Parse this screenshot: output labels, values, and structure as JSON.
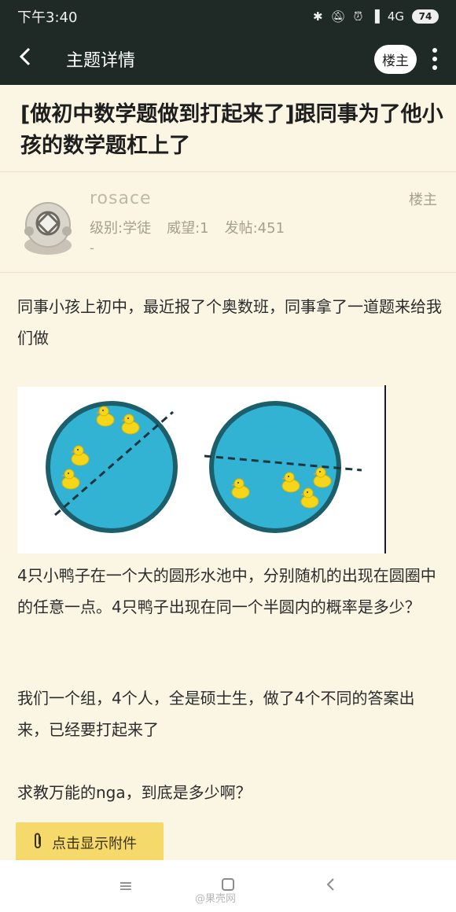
{
  "status_bar": {
    "time": "下午3:40",
    "network": "4G",
    "battery": "74"
  },
  "nav": {
    "title": "主题详情",
    "louzhu_button": "楼主"
  },
  "topic": {
    "title": "[做初中数学题做到打起来了]跟同事为了他小孩的数学题杠上了"
  },
  "author": {
    "username": "rosace",
    "role_label": "楼主",
    "level": "级别:学徒",
    "reputation": "威望:1",
    "posts": "发帖:451",
    "dash": "-"
  },
  "post": {
    "p1": "同事小孩上初中，最近报了个奥数班，同事拿了一道题来给我们做",
    "p2": "4只小鸭子在一个大的圆形水池中，分别随机的出现在圆圈中的任意一点。4只鸭子出现在同一个半圆内的概率是多少？",
    "p3": "我们一个组，4个人，全是硕士生，做了4个不同的答案出来，已经要打起来了",
    "p4": "求教万能的nga，到底是多少啊？",
    "attachment_label": "点击显示附件"
  },
  "colors": {
    "topbar": "#1f2a26",
    "background": "#fbf6e3",
    "pool": "#32b3d3",
    "pool_border": "#1d5e6b",
    "duck": "#f5d61a",
    "attachment": "#f5d96a"
  },
  "icons": [
    "back-arrow-icon",
    "more-vertical-icon",
    "paperclip-icon",
    "menu-icon",
    "home-icon",
    "back-icon"
  ],
  "watermark": "@果壳网"
}
